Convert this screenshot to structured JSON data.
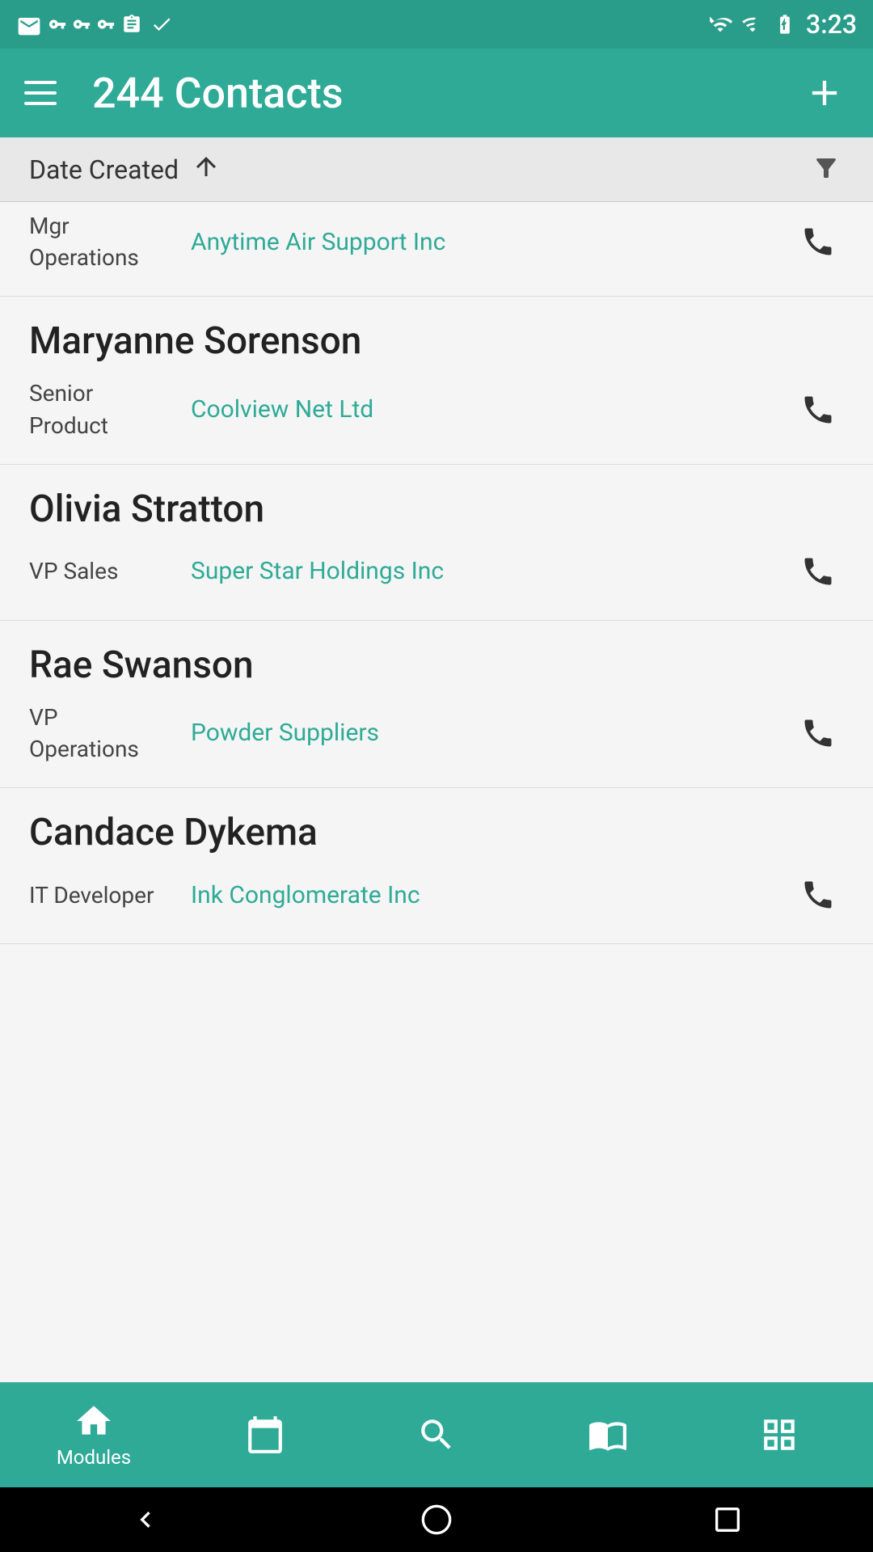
{
  "statusBar": {
    "time": "3:23"
  },
  "appBar": {
    "title": "244 Contacts",
    "addLabel": "+"
  },
  "sortBar": {
    "label": "Date Created",
    "sortDirection": "ascending"
  },
  "contacts": [
    {
      "name": "",
      "role": "Mgr\nOperations",
      "company": "Anytime Air Support Inc",
      "partial": true
    },
    {
      "name": "Maryanne Sorenson",
      "role": "Senior\nProduct",
      "company": "Coolview Net Ltd",
      "partial": false
    },
    {
      "name": "Olivia Stratton",
      "role": "VP Sales",
      "company": "Super Star Holdings Inc",
      "partial": false
    },
    {
      "name": "Rae Swanson",
      "role": "VP\nOperations",
      "company": "Powder Suppliers",
      "partial": false
    },
    {
      "name": "Candace Dykema",
      "role": "IT Developer",
      "company": "Ink Conglomerate Inc",
      "partial": false
    }
  ],
  "bottomNav": {
    "items": [
      {
        "label": "Modules",
        "icon": "home"
      },
      {
        "label": "",
        "icon": "calendar"
      },
      {
        "label": "",
        "icon": "search"
      },
      {
        "label": "",
        "icon": "book"
      },
      {
        "label": "",
        "icon": "grid"
      }
    ]
  }
}
